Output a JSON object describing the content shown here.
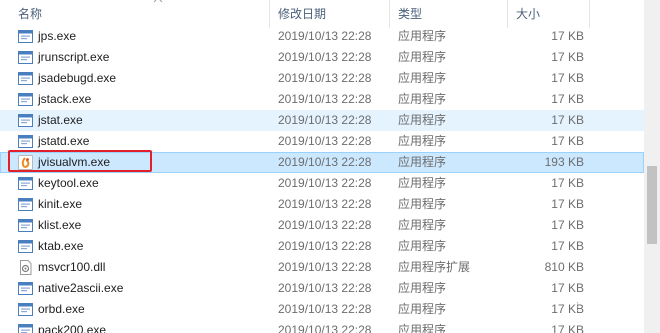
{
  "header": {
    "col_name": "名称",
    "col_date": "修改日期",
    "col_type": "类型",
    "col_size": "大小"
  },
  "files": [
    {
      "name": "jps.exe",
      "date": "2019/10/13 22:28",
      "type": "应用程序",
      "size": "17 KB",
      "icon": "exe-icon"
    },
    {
      "name": "jrunscript.exe",
      "date": "2019/10/13 22:28",
      "type": "应用程序",
      "size": "17 KB",
      "icon": "exe-icon"
    },
    {
      "name": "jsadebugd.exe",
      "date": "2019/10/13 22:28",
      "type": "应用程序",
      "size": "17 KB",
      "icon": "exe-icon"
    },
    {
      "name": "jstack.exe",
      "date": "2019/10/13 22:28",
      "type": "应用程序",
      "size": "17 KB",
      "icon": "exe-icon"
    },
    {
      "name": "jstat.exe",
      "date": "2019/10/13 22:28",
      "type": "应用程序",
      "size": "17 KB",
      "icon": "exe-icon"
    },
    {
      "name": "jstatd.exe",
      "date": "2019/10/13 22:28",
      "type": "应用程序",
      "size": "17 KB",
      "icon": "exe-icon"
    },
    {
      "name": "jvisualvm.exe",
      "date": "2019/10/13 22:28",
      "type": "应用程序",
      "size": "193 KB",
      "icon": "jvisualvm-icon"
    },
    {
      "name": "keytool.exe",
      "date": "2019/10/13 22:28",
      "type": "应用程序",
      "size": "17 KB",
      "icon": "exe-icon"
    },
    {
      "name": "kinit.exe",
      "date": "2019/10/13 22:28",
      "type": "应用程序",
      "size": "17 KB",
      "icon": "exe-icon"
    },
    {
      "name": "klist.exe",
      "date": "2019/10/13 22:28",
      "type": "应用程序",
      "size": "17 KB",
      "icon": "exe-icon"
    },
    {
      "name": "ktab.exe",
      "date": "2019/10/13 22:28",
      "type": "应用程序",
      "size": "17 KB",
      "icon": "exe-icon"
    },
    {
      "name": "msvcr100.dll",
      "date": "2019/10/13 22:28",
      "type": "应用程序扩展",
      "size": "810 KB",
      "icon": "dll-icon"
    },
    {
      "name": "native2ascii.exe",
      "date": "2019/10/13 22:28",
      "type": "应用程序",
      "size": "17 KB",
      "icon": "exe-icon"
    },
    {
      "name": "orbd.exe",
      "date": "2019/10/13 22:28",
      "type": "应用程序",
      "size": "17 KB",
      "icon": "exe-icon"
    },
    {
      "name": "pack200.exe",
      "date": "2019/10/13 22:28",
      "type": "应用程序",
      "size": "17 KB",
      "icon": "exe-icon"
    }
  ],
  "state": {
    "hover_index": 4,
    "selected_index": 6,
    "highlight_color": "#e0202a",
    "selection_color": "#cce8ff"
  }
}
